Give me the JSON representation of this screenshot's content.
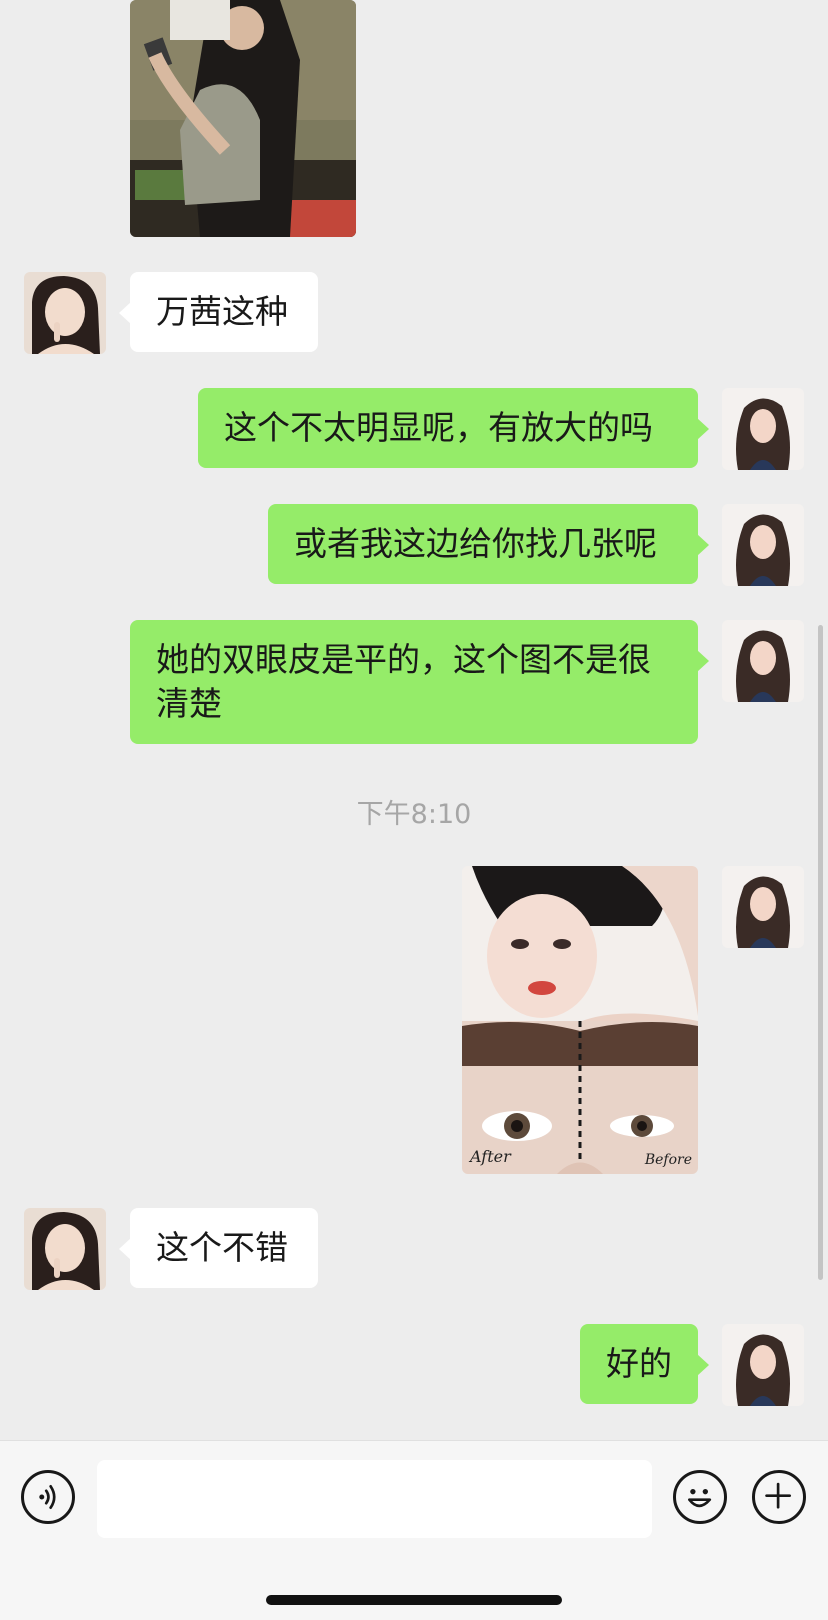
{
  "messages": [
    {
      "side": "left",
      "text": "万茜这种"
    },
    {
      "side": "right",
      "text": "这个不太明显呢，有放大的吗"
    },
    {
      "side": "right",
      "text": "或者我这边给你找几张呢"
    },
    {
      "side": "right",
      "text": "她的双眼皮是平的，这个图不是很清楚"
    },
    {
      "side": "left",
      "text": "这个不错"
    },
    {
      "side": "right",
      "text": "好的"
    }
  ],
  "timestamp": "下午8:10",
  "collage_labels": {
    "after": "After",
    "before": "Before"
  },
  "input": {
    "value": "",
    "placeholder": ""
  },
  "icons": {
    "voice": "voice-icon",
    "emoji": "emoji-icon",
    "plus": "plus-icon"
  },
  "colors": {
    "background": "#ededed",
    "sent_bubble": "#95ec69",
    "received_bubble": "#ffffff",
    "timestamp": "#a6a6a6"
  }
}
